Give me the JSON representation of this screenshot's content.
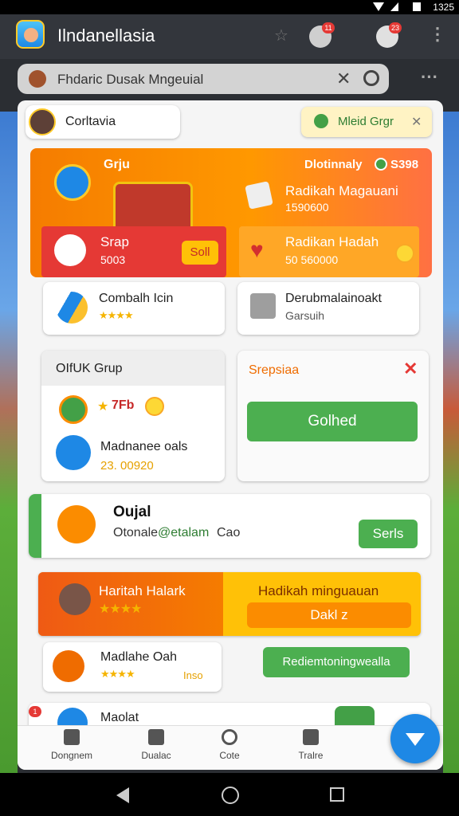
{
  "status_bar": {
    "time": "1325"
  },
  "app": {
    "title": "Ilndanellasia"
  },
  "search": {
    "text": "Fhdaric Dusak Mngeuial"
  },
  "profile": {
    "name": "Corltavia"
  },
  "group_tag": {
    "label": "Mleid Grgr"
  },
  "hero": {
    "title": "Grju",
    "daily": "Dlotinnaly",
    "daily_count": "S398",
    "title2": "Radikah Magauani",
    "sub2": "1590600",
    "left_title": "Srap",
    "left_sub": "5003",
    "left_button": "Soll",
    "right_title": "Radikan Hadah",
    "right_sub": "50 560000"
  },
  "cards_row": {
    "left_title": "Combalh Icin",
    "right_title": "Derubmalainoakt",
    "right_sub": "Garsuih"
  },
  "group_card": {
    "title": "OIfUK Grup",
    "stars_value": "7Fb",
    "person_name": "Madnanee oals",
    "person_value": "23. 00920"
  },
  "side_card": {
    "title": "Srepsiaa",
    "button": "Golhed"
  },
  "quest": {
    "title": "Oujal",
    "sub_prefix": "Otonale",
    "sub_green": "@etalam",
    "sub_suffix": "Cao",
    "button": "Serls"
  },
  "banner": {
    "left_title": "Haritah Halark",
    "right_title": "Hadikah minguauan",
    "right_button": "Dakl z"
  },
  "promo": {
    "title": "Madlahe Oah",
    "tag": "Inso",
    "button": "Rediemtoningwealla"
  },
  "bottom_item": {
    "title": "Maolat"
  },
  "bottom_nav": [
    "Dongnem",
    "Dualac",
    "Cote",
    "Tralre"
  ],
  "colors": {
    "accent_orange": "#ff9800",
    "accent_green": "#4caf50",
    "accent_blue": "#1e88e5"
  }
}
